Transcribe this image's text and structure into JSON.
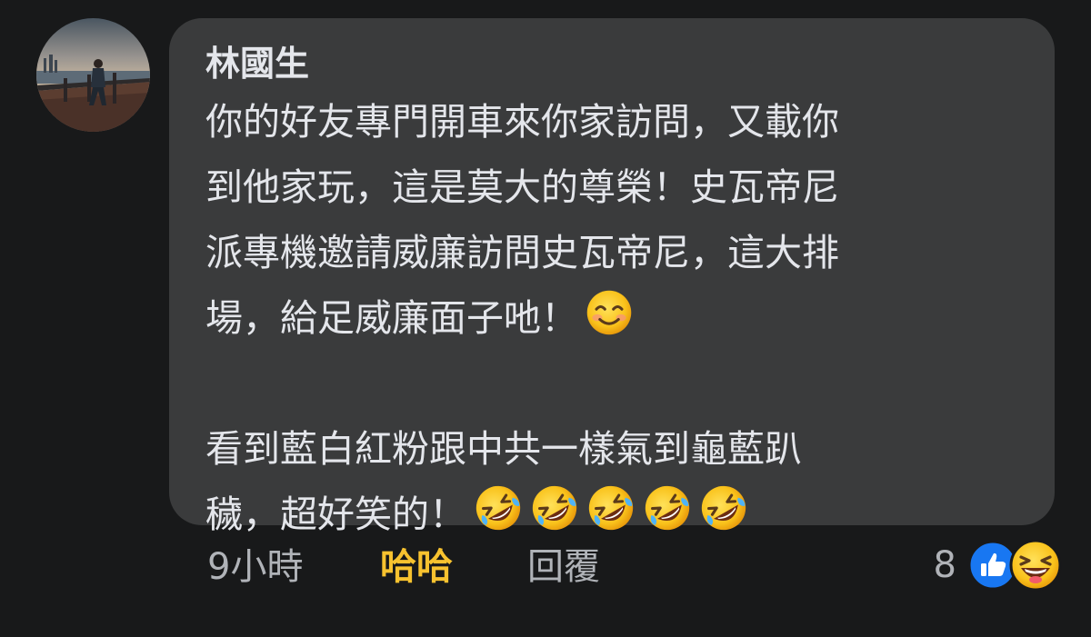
{
  "comment": {
    "author": "林國生",
    "paragraph_1": [
      "你的好友專門開車來你家訪問，又載你",
      "到他家玩，這是莫大的尊榮！史瓦帝尼",
      "派專機邀請威廉訪問史瓦帝尼，這大排",
      "場，給足威廉面子吔！"
    ],
    "paragraph_1_emoji": "smiling-face-icon",
    "paragraph_2": [
      "看到藍白紅粉跟中共一樣氣到龜藍趴",
      "穢，超好笑的！"
    ],
    "paragraph_2_emoji": [
      "rofl-icon",
      "rofl-icon",
      "rofl-icon",
      "rofl-icon",
      "rofl-icon"
    ]
  },
  "actions": {
    "time": "9小時",
    "reaction": "哈哈",
    "reply": "回覆"
  },
  "reactions": {
    "count": "8",
    "icons": [
      "like-icon",
      "haha-icon"
    ]
  },
  "colors": {
    "background": "#18191a",
    "bubble": "#3a3b3c",
    "text": "#e4e6eb",
    "secondary_text": "#b0b3b8",
    "haha_active": "#f7c22f",
    "like_blue": "#1877f2"
  }
}
